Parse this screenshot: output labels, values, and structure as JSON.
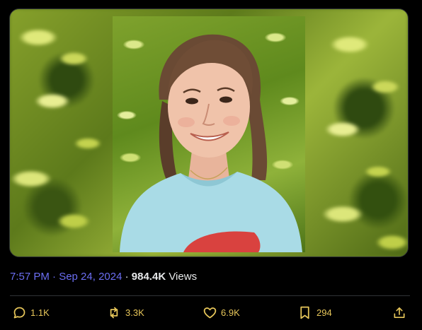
{
  "tweet": {
    "time": "7:57 PM · Sep 24, 2024",
    "separator": " · ",
    "views_count": "984.4K",
    "views_label": " Views"
  },
  "actions": {
    "replies": "1.1K",
    "reposts": "3.3K",
    "likes": "6.9K",
    "bookmarks": "294"
  },
  "icons": {
    "reply": "reply-icon",
    "repost": "repost-icon",
    "like": "heart-icon",
    "bookmark": "bookmark-icon",
    "share": "share-icon"
  },
  "colors": {
    "background": "#000000",
    "timestamp": "#6b6ef2",
    "metric": "#e7c65a",
    "text": "#e7e9ea",
    "divider": "#2f3336"
  }
}
